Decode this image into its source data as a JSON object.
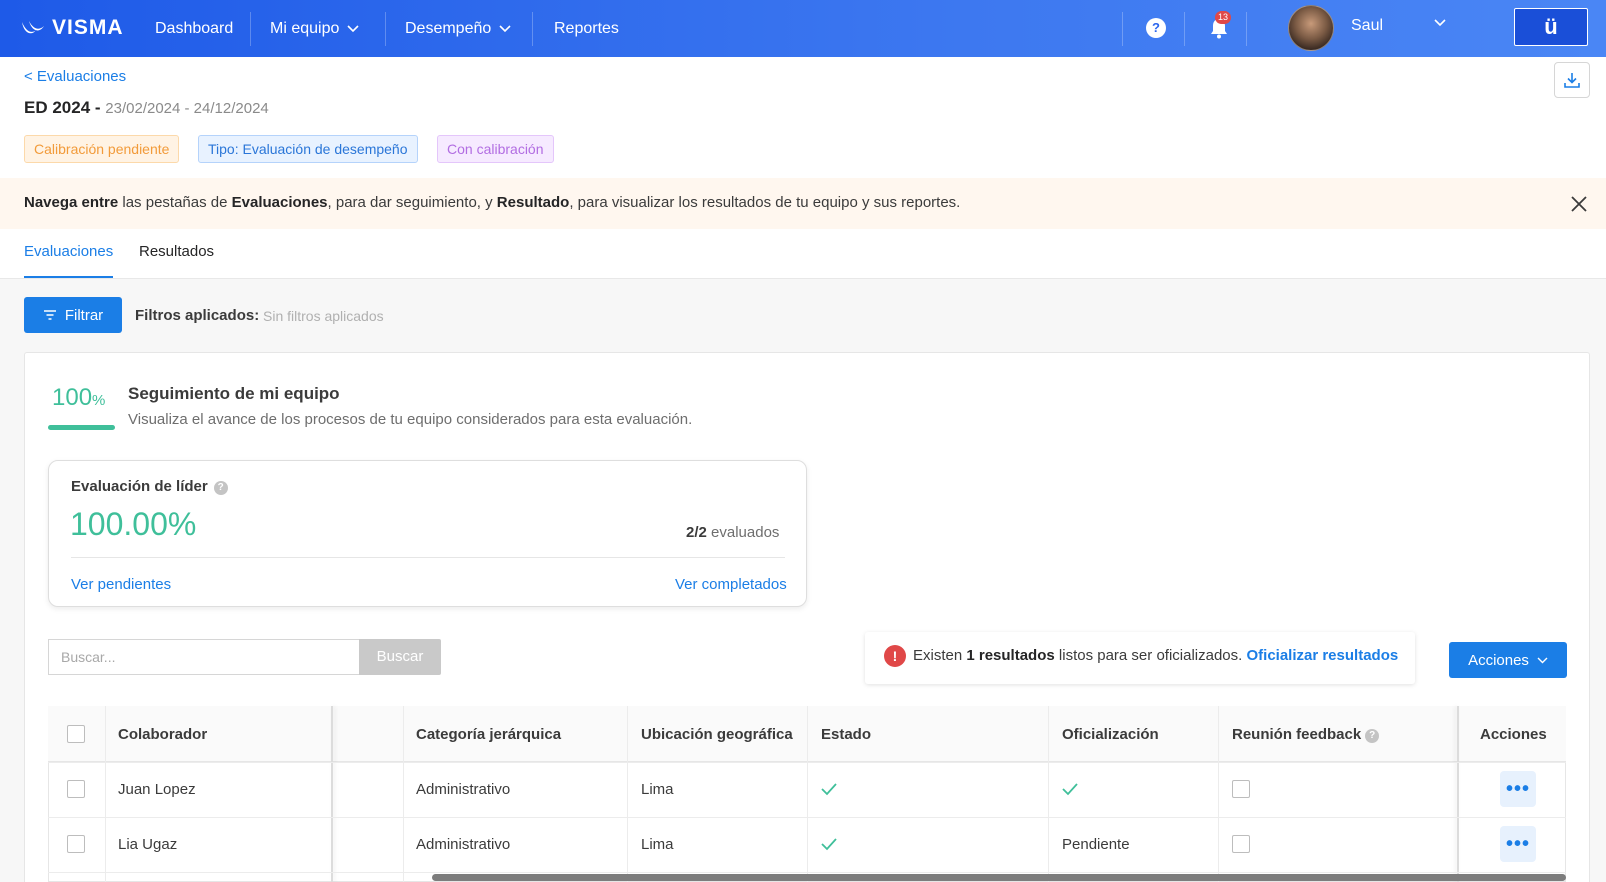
{
  "nav": {
    "brand": "VISMA",
    "items": [
      {
        "label": "Dashboard"
      },
      {
        "label": "Mi equipo"
      },
      {
        "label": "Desempeño"
      },
      {
        "label": "Reportes"
      }
    ],
    "help": "?",
    "notifications_count": "13",
    "user_name": "Saul",
    "app_button": "ü"
  },
  "header": {
    "back_link": "< Evaluaciones",
    "title": "ED 2024 -",
    "dates": "23/02/2024 - 24/12/2024",
    "tags": {
      "status": "Calibración pendiente",
      "type": "Tipo: Evaluación de desempeño",
      "calibration": "Con calibración"
    }
  },
  "banner": {
    "b1": "Navega entre",
    "t1": " las pestañas de ",
    "b2": "Evaluaciones",
    "t2": ", para dar seguimiento, y ",
    "b3": "Resultado",
    "t3": ", para visualizar los resultados de tu equipo y sus reportes."
  },
  "tabs": {
    "evaluaciones": "Evaluaciones",
    "resultados": "Resultados"
  },
  "filters": {
    "button": "Filtrar",
    "label": "Filtros aplicados:",
    "value": "Sin filtros aplicados"
  },
  "tracking": {
    "percent": "100",
    "percent_symbol": "%",
    "progress": 1.0,
    "title": "Seguimiento de mi equipo",
    "subtitle": "Visualiza el avance de los procesos de tu equipo considerados para esta evaluación."
  },
  "leader": {
    "title": "Evaluación de líder",
    "info": "?",
    "percent": "100.00%",
    "evaluated_count": "2/2",
    "evaluated_label": " evaluados",
    "link_pending": "Ver pendientes",
    "link_completed": "Ver completados"
  },
  "search": {
    "placeholder": "Buscar...",
    "button": "Buscar"
  },
  "alert": {
    "icon": "!",
    "t1": "Existen ",
    "count": "1 resultados",
    "t2": " listos para ser oficializados. ",
    "link": "Oficializar resultados"
  },
  "actions_button": "Acciones",
  "table": {
    "headers": {
      "colaborador": "Colaborador",
      "categoria": "Categoría jerárquica",
      "ubicacion": "Ubicación geográfica",
      "estado": "Estado",
      "oficializacion": "Oficialización",
      "reunion": "Reunión feedback",
      "acciones": "Acciones"
    },
    "rows": [
      {
        "colaborador": "Juan Lopez",
        "categoria": "Administrativo",
        "ubicacion": "Lima",
        "estado": "done",
        "oficializacion": "done",
        "oficializacion_text": "",
        "reunion": false,
        "more": "•••"
      },
      {
        "colaborador": "Lia Ugaz",
        "categoria": "Administrativo",
        "ubicacion": "Lima",
        "estado": "done",
        "oficializacion": "pending",
        "oficializacion_text": "Pendiente",
        "reunion": false,
        "more": "•••"
      }
    ]
  },
  "colors": {
    "primary": "#1b7ee6",
    "success": "#3fbf9a",
    "danger": "#e04848"
  }
}
